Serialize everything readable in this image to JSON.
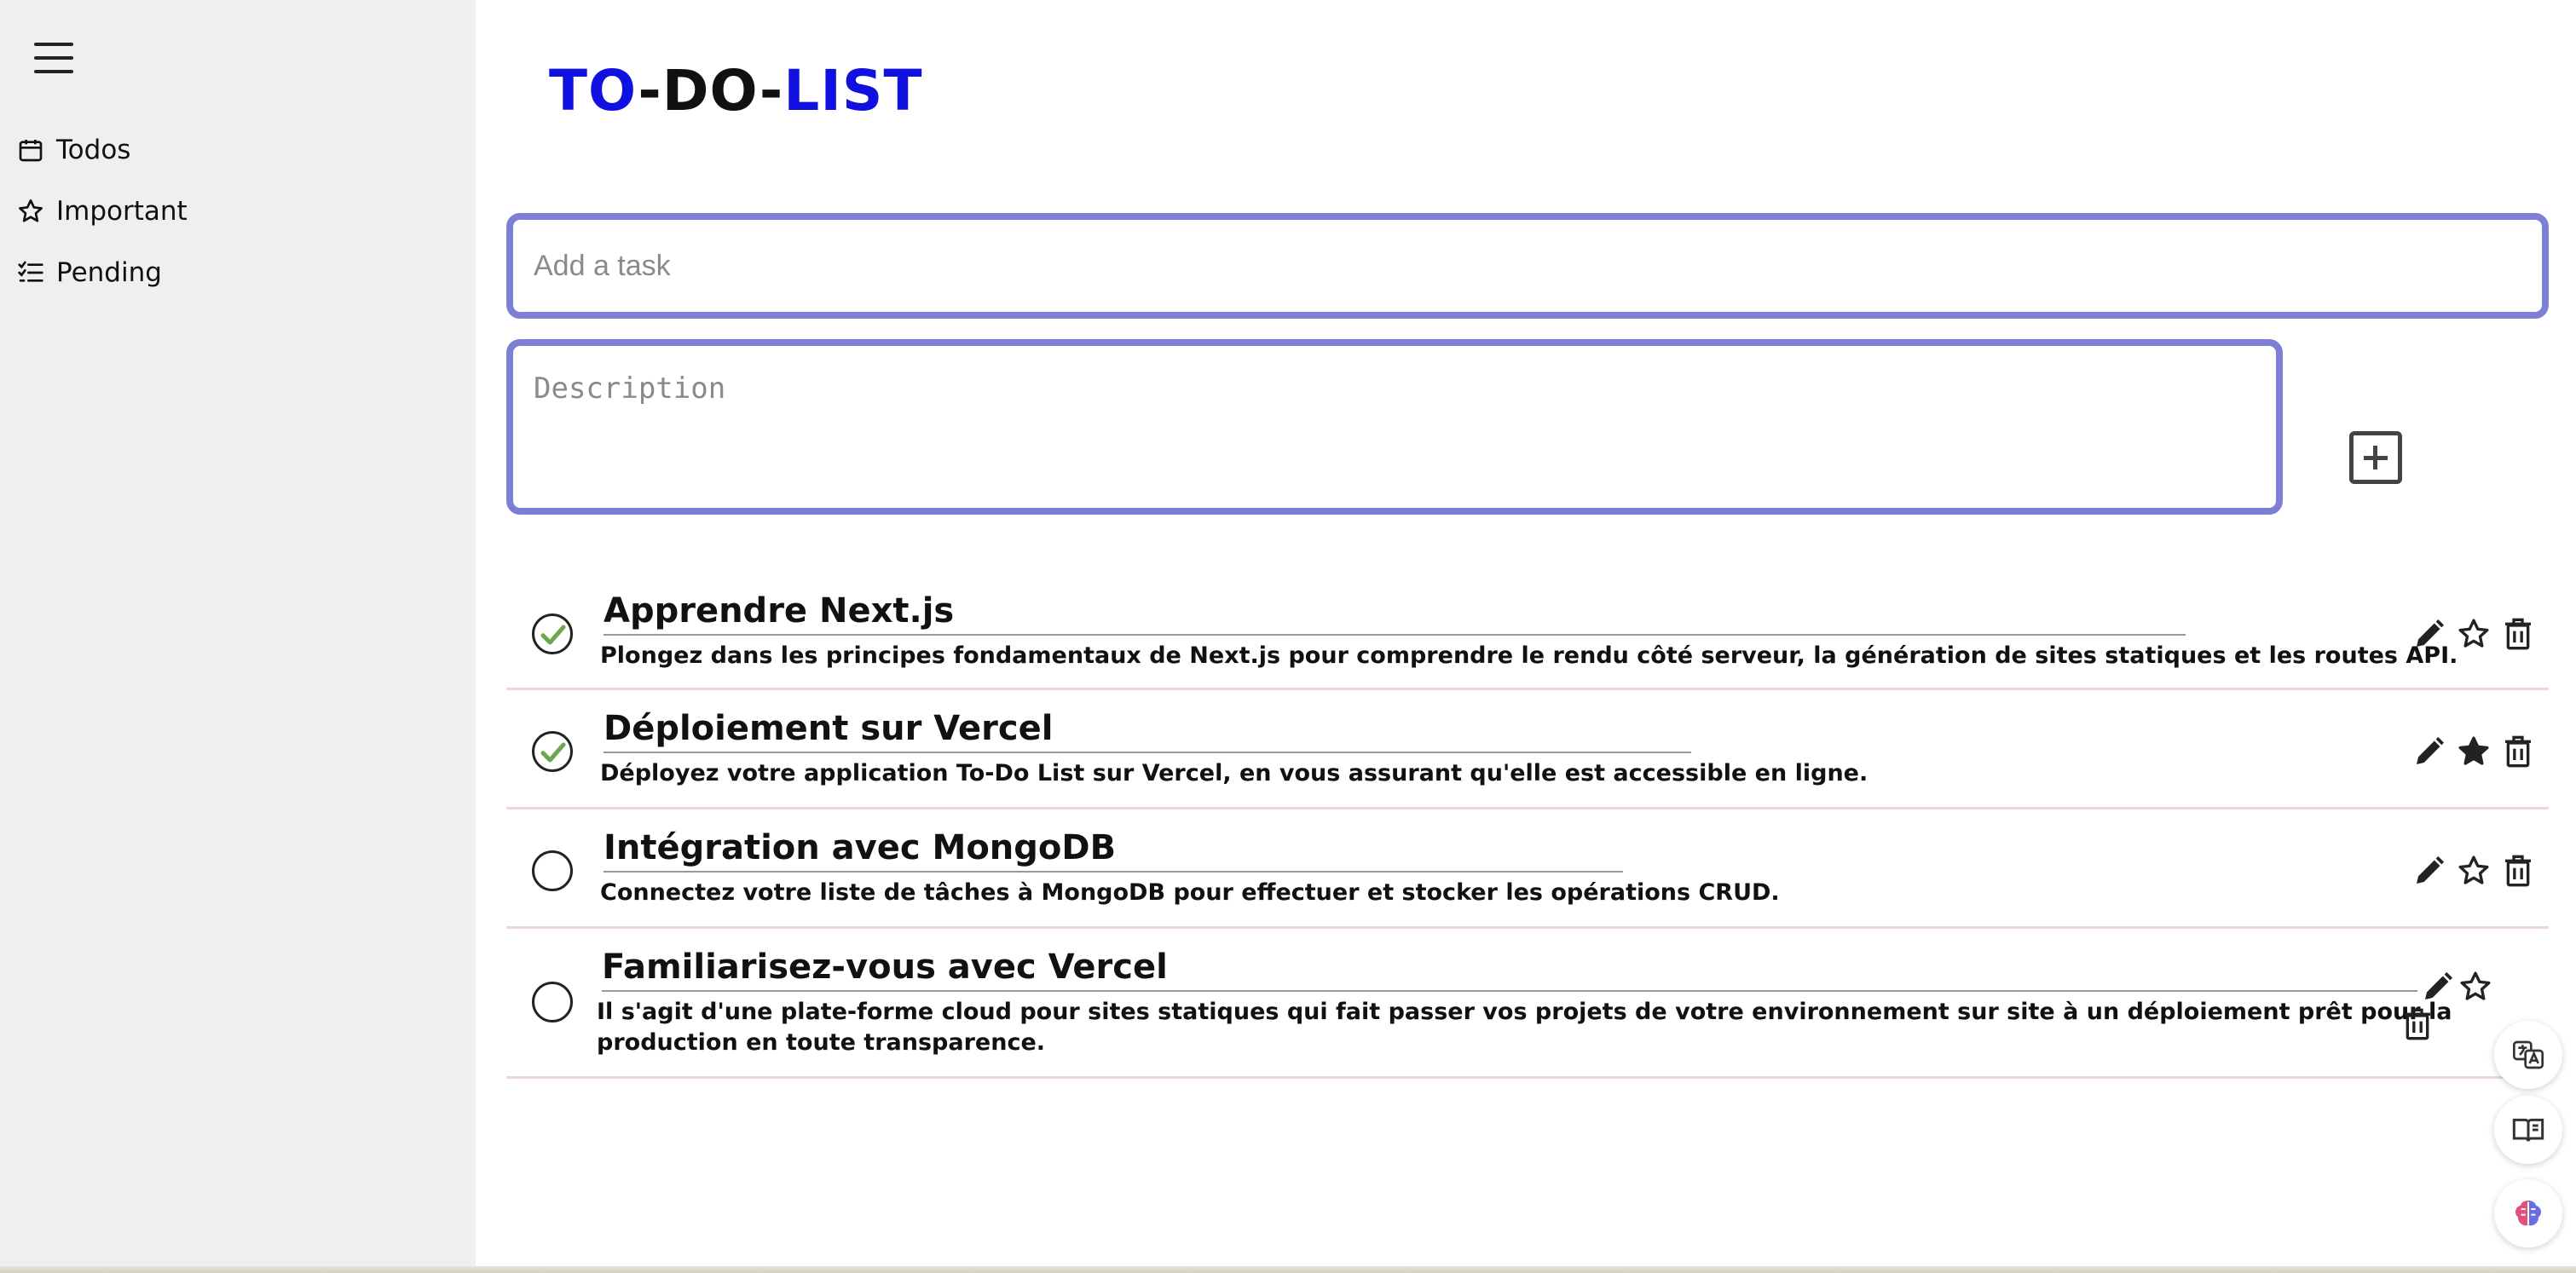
{
  "sidebar": {
    "items": [
      {
        "label": "Todos",
        "icon": "calendar-icon"
      },
      {
        "label": "Important",
        "icon": "star-icon"
      },
      {
        "label": "Pending",
        "icon": "checklist-icon"
      }
    ]
  },
  "header": {
    "title_part1": "TO",
    "title_sep1": "-",
    "title_part2": "DO",
    "title_sep2": "-",
    "title_part3": "LIST"
  },
  "form": {
    "task_placeholder": "Add a task",
    "description_placeholder": "Description"
  },
  "todos": [
    {
      "title": "Apprendre Next.js",
      "description": "Plongez dans les principes fondamentaux de Next.js pour comprendre le rendu côté serveur, la génération de sites statiques et les routes API.",
      "completed": true,
      "important": false
    },
    {
      "title": "Déploiement sur Vercel",
      "description": "Déployez votre application To-Do List sur Vercel, en vous assurant qu'elle est accessible en ligne.",
      "completed": true,
      "important": true
    },
    {
      "title": "Intégration avec MongoDB",
      "description": "Connectez votre liste de tâches à MongoDB pour effectuer et stocker les opérations CRUD.",
      "completed": false,
      "important": false
    },
    {
      "title": "Familiarisez-vous avec Vercel",
      "description": "Il s'agit d'une plate-forme cloud pour sites statiques qui fait passer vos projets de votre environnement sur site à un déploiement prêt pour la production en toute transparence.",
      "completed": false,
      "important": false
    }
  ],
  "colors": {
    "accent_blue": "#1010e0",
    "input_border": "#7d7ed6",
    "check_green": "#6aa84f",
    "sidebar_bg": "#efefef"
  }
}
